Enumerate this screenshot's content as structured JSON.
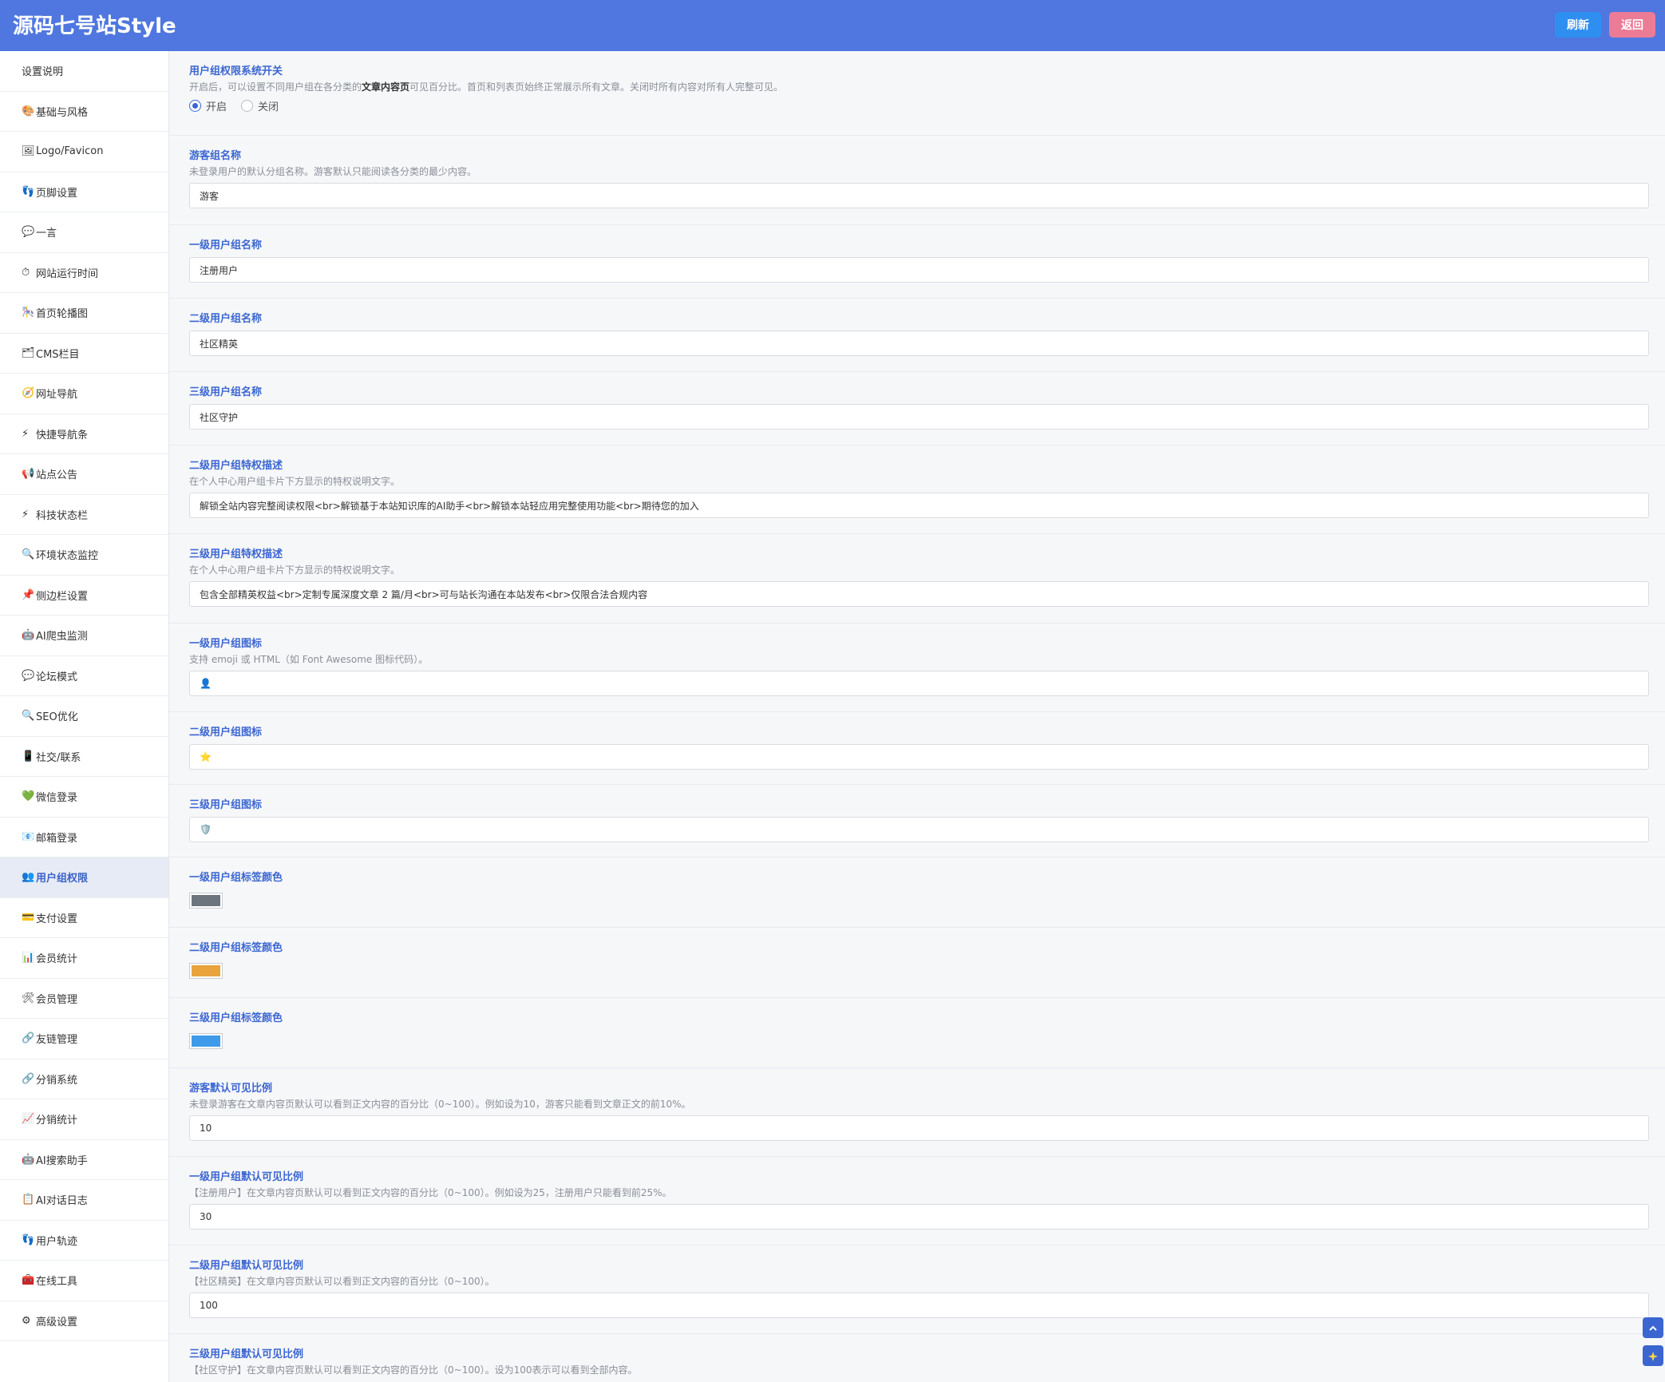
{
  "header": {
    "title": "源码七号站Style",
    "refresh_label": "刷新",
    "back_label": "返回"
  },
  "sidebar": {
    "items": [
      {
        "icon": "",
        "label": "设置说明"
      },
      {
        "icon": "🎨",
        "label": "基础与风格"
      },
      {
        "icon": "🖼",
        "label": "Logo/Favicon"
      },
      {
        "icon": "👣",
        "label": "页脚设置"
      },
      {
        "icon": "💬",
        "label": "一言"
      },
      {
        "icon": "⏱",
        "label": "网站运行时间"
      },
      {
        "icon": "🎠",
        "label": "首页轮播图"
      },
      {
        "icon": "🗂",
        "label": "CMS栏目"
      },
      {
        "icon": "🧭",
        "label": "网址导航"
      },
      {
        "icon": "⚡",
        "label": "快捷导航条"
      },
      {
        "icon": "📢",
        "label": "站点公告"
      },
      {
        "icon": "⚡",
        "label": "科技状态栏"
      },
      {
        "icon": "🔍",
        "label": "环境状态监控"
      },
      {
        "icon": "📌",
        "label": "侧边栏设置"
      },
      {
        "icon": "🤖",
        "label": "AI爬虫监测"
      },
      {
        "icon": "💬",
        "label": "论坛模式"
      },
      {
        "icon": "🔍",
        "label": "SEO优化"
      },
      {
        "icon": "📱",
        "label": "社交/联系"
      },
      {
        "icon": "💚",
        "label": "微信登录"
      },
      {
        "icon": "📧",
        "label": "邮箱登录"
      },
      {
        "icon": "👥",
        "label": "用户组权限"
      },
      {
        "icon": "💳",
        "label": "支付设置"
      },
      {
        "icon": "📊",
        "label": "会员统计"
      },
      {
        "icon": "🛠",
        "label": "会员管理"
      },
      {
        "icon": "🔗",
        "label": "友链管理"
      },
      {
        "icon": "🔗",
        "label": "分销系统"
      },
      {
        "icon": "📈",
        "label": "分销统计"
      },
      {
        "icon": "🤖",
        "label": "AI搜索助手"
      },
      {
        "icon": "📋",
        "label": "AI对话日志"
      },
      {
        "icon": "👣",
        "label": "用户轨迹"
      },
      {
        "icon": "🧰",
        "label": "在线工具"
      },
      {
        "icon": "⚙",
        "label": "高级设置"
      }
    ],
    "active_label": "用户组权限"
  },
  "settings": {
    "switch": {
      "title": "用户组权限系统开关",
      "desc_pre": "开启后，可以设置不同用户组在各分类的",
      "desc_bold": "文章内容页",
      "desc_post": "可见百分比。首页和列表页始终正常展示所有文章。关闭时所有内容对所有人完整可见。",
      "on_label": "开启",
      "off_label": "关闭",
      "selected": "开启"
    },
    "guest_name": {
      "title": "游客组名称",
      "desc": "未登录用户的默认分组名称。游客默认只能阅读各分类的最少内容。",
      "value": "游客"
    },
    "level1_name": {
      "title": "一级用户组名称",
      "value": "注册用户"
    },
    "level2_name": {
      "title": "二级用户组名称",
      "value": "社区精英"
    },
    "level3_name": {
      "title": "三级用户组名称",
      "value": "社区守护"
    },
    "level2_desc": {
      "title": "二级用户组特权描述",
      "desc": "在个人中心用户组卡片下方显示的特权说明文字。",
      "value": "解锁全站内容完整阅读权限<br>解锁基于本站知识库的AI助手<br>解锁本站轻应用完整使用功能<br>期待您的加入"
    },
    "level3_desc": {
      "title": "三级用户组特权描述",
      "desc": "在个人中心用户组卡片下方显示的特权说明文字。",
      "value": "包含全部精英权益<br>定制专属深度文章 2 篇/月<br>可与站长沟通在本站发布<br>仅限合法合规内容"
    },
    "level1_icon": {
      "title": "一级用户组图标",
      "desc": "支持 emoji 或 HTML（如 Font Awesome 图标代码）。",
      "value": "👤"
    },
    "level2_icon": {
      "title": "二级用户组图标",
      "value": "⭐"
    },
    "level3_icon": {
      "title": "三级用户组图标",
      "value": "🛡️"
    },
    "level1_color": {
      "title": "一级用户组标签颜色",
      "color": "#6c757d"
    },
    "level2_color": {
      "title": "二级用户组标签颜色",
      "color": "#e8a33d"
    },
    "level3_color": {
      "title": "三级用户组标签颜色",
      "color": "#3d9be9"
    },
    "guest_ratio": {
      "title": "游客默认可见比例",
      "desc": "未登录游客在文章内容页默认可以看到正文内容的百分比（0~100）。例如设为10，游客只能看到文章正文的前10%。",
      "value": "10"
    },
    "level1_ratio": {
      "title": "一级用户组默认可见比例",
      "desc": "【注册用户】在文章内容页默认可以看到正文内容的百分比（0~100）。例如设为25，注册用户只能看到前25%。",
      "value": "30"
    },
    "level2_ratio": {
      "title": "二级用户组默认可见比例",
      "desc": "【社区精英】在文章内容页默认可以看到正文内容的百分比（0~100）。",
      "value": "100"
    },
    "level3_ratio": {
      "title": "三级用户组默认可见比例",
      "desc": "【社区守护】在文章内容页默认可以看到正文内容的百分比（0~100）。设为100表示可以看到全部内容。"
    }
  },
  "floating": {
    "top_icon": "chevron-up-icon",
    "tool_icon": "sparkle-icon"
  }
}
